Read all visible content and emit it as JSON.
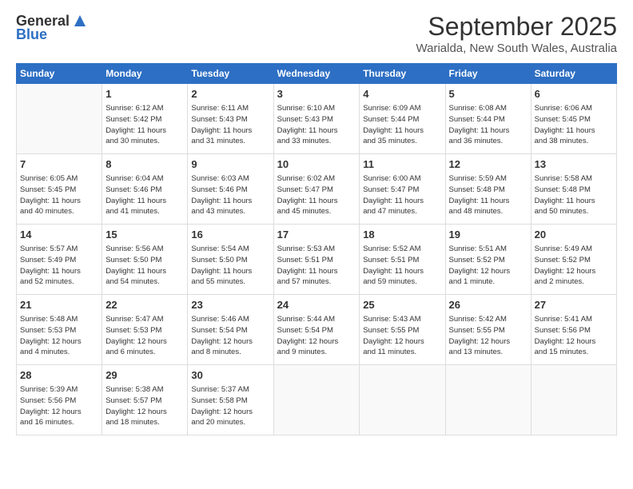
{
  "header": {
    "logo_line1": "General",
    "logo_line2": "Blue",
    "month_title": "September 2025",
    "location": "Warialda, New South Wales, Australia"
  },
  "days_of_week": [
    "Sunday",
    "Monday",
    "Tuesday",
    "Wednesday",
    "Thursday",
    "Friday",
    "Saturday"
  ],
  "weeks": [
    [
      {
        "day": "",
        "info": ""
      },
      {
        "day": "1",
        "info": "Sunrise: 6:12 AM\nSunset: 5:42 PM\nDaylight: 11 hours\nand 30 minutes."
      },
      {
        "day": "2",
        "info": "Sunrise: 6:11 AM\nSunset: 5:43 PM\nDaylight: 11 hours\nand 31 minutes."
      },
      {
        "day": "3",
        "info": "Sunrise: 6:10 AM\nSunset: 5:43 PM\nDaylight: 11 hours\nand 33 minutes."
      },
      {
        "day": "4",
        "info": "Sunrise: 6:09 AM\nSunset: 5:44 PM\nDaylight: 11 hours\nand 35 minutes."
      },
      {
        "day": "5",
        "info": "Sunrise: 6:08 AM\nSunset: 5:44 PM\nDaylight: 11 hours\nand 36 minutes."
      },
      {
        "day": "6",
        "info": "Sunrise: 6:06 AM\nSunset: 5:45 PM\nDaylight: 11 hours\nand 38 minutes."
      }
    ],
    [
      {
        "day": "7",
        "info": "Sunrise: 6:05 AM\nSunset: 5:45 PM\nDaylight: 11 hours\nand 40 minutes."
      },
      {
        "day": "8",
        "info": "Sunrise: 6:04 AM\nSunset: 5:46 PM\nDaylight: 11 hours\nand 41 minutes."
      },
      {
        "day": "9",
        "info": "Sunrise: 6:03 AM\nSunset: 5:46 PM\nDaylight: 11 hours\nand 43 minutes."
      },
      {
        "day": "10",
        "info": "Sunrise: 6:02 AM\nSunset: 5:47 PM\nDaylight: 11 hours\nand 45 minutes."
      },
      {
        "day": "11",
        "info": "Sunrise: 6:00 AM\nSunset: 5:47 PM\nDaylight: 11 hours\nand 47 minutes."
      },
      {
        "day": "12",
        "info": "Sunrise: 5:59 AM\nSunset: 5:48 PM\nDaylight: 11 hours\nand 48 minutes."
      },
      {
        "day": "13",
        "info": "Sunrise: 5:58 AM\nSunset: 5:48 PM\nDaylight: 11 hours\nand 50 minutes."
      }
    ],
    [
      {
        "day": "14",
        "info": "Sunrise: 5:57 AM\nSunset: 5:49 PM\nDaylight: 11 hours\nand 52 minutes."
      },
      {
        "day": "15",
        "info": "Sunrise: 5:56 AM\nSunset: 5:50 PM\nDaylight: 11 hours\nand 54 minutes."
      },
      {
        "day": "16",
        "info": "Sunrise: 5:54 AM\nSunset: 5:50 PM\nDaylight: 11 hours\nand 55 minutes."
      },
      {
        "day": "17",
        "info": "Sunrise: 5:53 AM\nSunset: 5:51 PM\nDaylight: 11 hours\nand 57 minutes."
      },
      {
        "day": "18",
        "info": "Sunrise: 5:52 AM\nSunset: 5:51 PM\nDaylight: 11 hours\nand 59 minutes."
      },
      {
        "day": "19",
        "info": "Sunrise: 5:51 AM\nSunset: 5:52 PM\nDaylight: 12 hours\nand 1 minute."
      },
      {
        "day": "20",
        "info": "Sunrise: 5:49 AM\nSunset: 5:52 PM\nDaylight: 12 hours\nand 2 minutes."
      }
    ],
    [
      {
        "day": "21",
        "info": "Sunrise: 5:48 AM\nSunset: 5:53 PM\nDaylight: 12 hours\nand 4 minutes."
      },
      {
        "day": "22",
        "info": "Sunrise: 5:47 AM\nSunset: 5:53 PM\nDaylight: 12 hours\nand 6 minutes."
      },
      {
        "day": "23",
        "info": "Sunrise: 5:46 AM\nSunset: 5:54 PM\nDaylight: 12 hours\nand 8 minutes."
      },
      {
        "day": "24",
        "info": "Sunrise: 5:44 AM\nSunset: 5:54 PM\nDaylight: 12 hours\nand 9 minutes."
      },
      {
        "day": "25",
        "info": "Sunrise: 5:43 AM\nSunset: 5:55 PM\nDaylight: 12 hours\nand 11 minutes."
      },
      {
        "day": "26",
        "info": "Sunrise: 5:42 AM\nSunset: 5:55 PM\nDaylight: 12 hours\nand 13 minutes."
      },
      {
        "day": "27",
        "info": "Sunrise: 5:41 AM\nSunset: 5:56 PM\nDaylight: 12 hours\nand 15 minutes."
      }
    ],
    [
      {
        "day": "28",
        "info": "Sunrise: 5:39 AM\nSunset: 5:56 PM\nDaylight: 12 hours\nand 16 minutes."
      },
      {
        "day": "29",
        "info": "Sunrise: 5:38 AM\nSunset: 5:57 PM\nDaylight: 12 hours\nand 18 minutes."
      },
      {
        "day": "30",
        "info": "Sunrise: 5:37 AM\nSunset: 5:58 PM\nDaylight: 12 hours\nand 20 minutes."
      },
      {
        "day": "",
        "info": ""
      },
      {
        "day": "",
        "info": ""
      },
      {
        "day": "",
        "info": ""
      },
      {
        "day": "",
        "info": ""
      }
    ]
  ]
}
